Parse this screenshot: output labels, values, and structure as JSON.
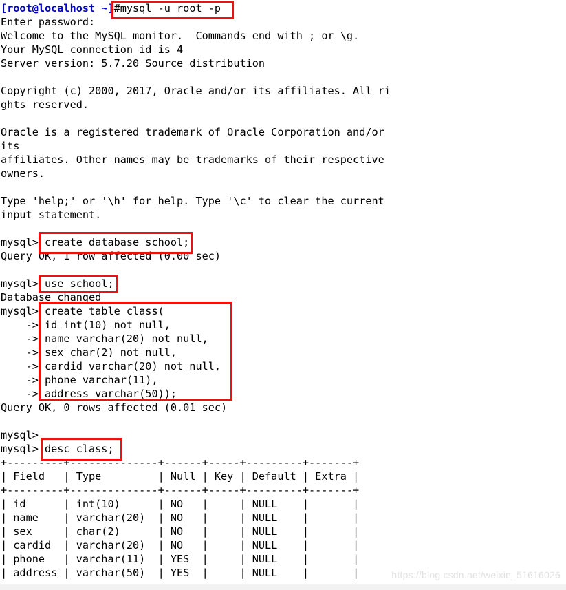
{
  "terminal": {
    "shell_prompt": "[root@localhost ~]",
    "shell_command": "#mysql -u root -p",
    "lines": [
      "Enter password:",
      "Welcome to the MySQL monitor.  Commands end with ; or \\g.",
      "Your MySQL connection id is 4",
      "Server version: 5.7.20 Source distribution",
      "",
      "Copyright (c) 2000, 2017, Oracle and/or its affiliates. All ri",
      "ghts reserved.",
      "",
      "Oracle is a registered trademark of Oracle Corporation and/or",
      "its",
      "affiliates. Other names may be trademarks of their respective",
      "owners.",
      "",
      "Type 'help;' or '\\h' for help. Type '\\c' to clear the current",
      "input statement.",
      ""
    ],
    "session": [
      "mysql> create database school;",
      "Query OK, 1 row affected (0.00 sec)",
      "",
      "mysql> use school;",
      "Database changed",
      "mysql> create table class(",
      "    -> id int(10) not null,",
      "    -> name varchar(20) not null,",
      "    -> sex char(2) not null,",
      "    -> cardid varchar(20) not null,",
      "    -> phone varchar(11),",
      "    -> address varchar(50));",
      "Query OK, 0 rows affected (0.01 sec)",
      "",
      "mysql>",
      "mysql> desc class;"
    ],
    "result_table": [
      "+---------+--------------+------+-----+---------+-------+",
      "| Field   | Type         | Null | Key | Default | Extra |",
      "+---------+--------------+------+-----+---------+-------+",
      "| id      | int(10)      | NO   |     | NULL    |       |",
      "| name    | varchar(20)  | NO   |     | NULL    |       |",
      "| sex     | char(2)      | NO   |     | NULL    |       |",
      "| cardid  | varchar(20)  | NO   |     | NULL    |       |",
      "| phone   | varchar(11)  | YES  |     | NULL    |       |",
      "| address | varchar(50)  | YES  |     | NULL    |       |"
    ],
    "table_columns": [
      "Field",
      "Type",
      "Null",
      "Key",
      "Default",
      "Extra"
    ],
    "table_rows": [
      {
        "field": "id",
        "type": "int(10)",
        "null": "NO",
        "key": "",
        "default": "NULL",
        "extra": ""
      },
      {
        "field": "name",
        "type": "varchar(20)",
        "null": "NO",
        "key": "",
        "default": "NULL",
        "extra": ""
      },
      {
        "field": "sex",
        "type": "char(2)",
        "null": "NO",
        "key": "",
        "default": "NULL",
        "extra": ""
      },
      {
        "field": "cardid",
        "type": "varchar(20)",
        "null": "NO",
        "key": "",
        "default": "NULL",
        "extra": ""
      },
      {
        "field": "phone",
        "type": "varchar(11)",
        "null": "YES",
        "key": "",
        "default": "NULL",
        "extra": ""
      },
      {
        "field": "address",
        "type": "varchar(50)",
        "null": "YES",
        "key": "",
        "default": "NULL",
        "extra": ""
      }
    ]
  },
  "annotations": {
    "highlight_color": "#ee1111",
    "boxes": [
      {
        "label": "mysql -u root -p"
      },
      {
        "label": "create database school;"
      },
      {
        "label": "use school;"
      },
      {
        "label": "create table class( ... address varchar(50));"
      },
      {
        "label": "desc class;"
      }
    ]
  },
  "watermark": {
    "text": "https://blog.csdn.net/weixin_51616026"
  },
  "colors": {
    "background": "#ffffff",
    "text": "#000000",
    "prompt": "#0000cc",
    "highlight": "#ee1111",
    "watermark": "#e2e2e2"
  }
}
